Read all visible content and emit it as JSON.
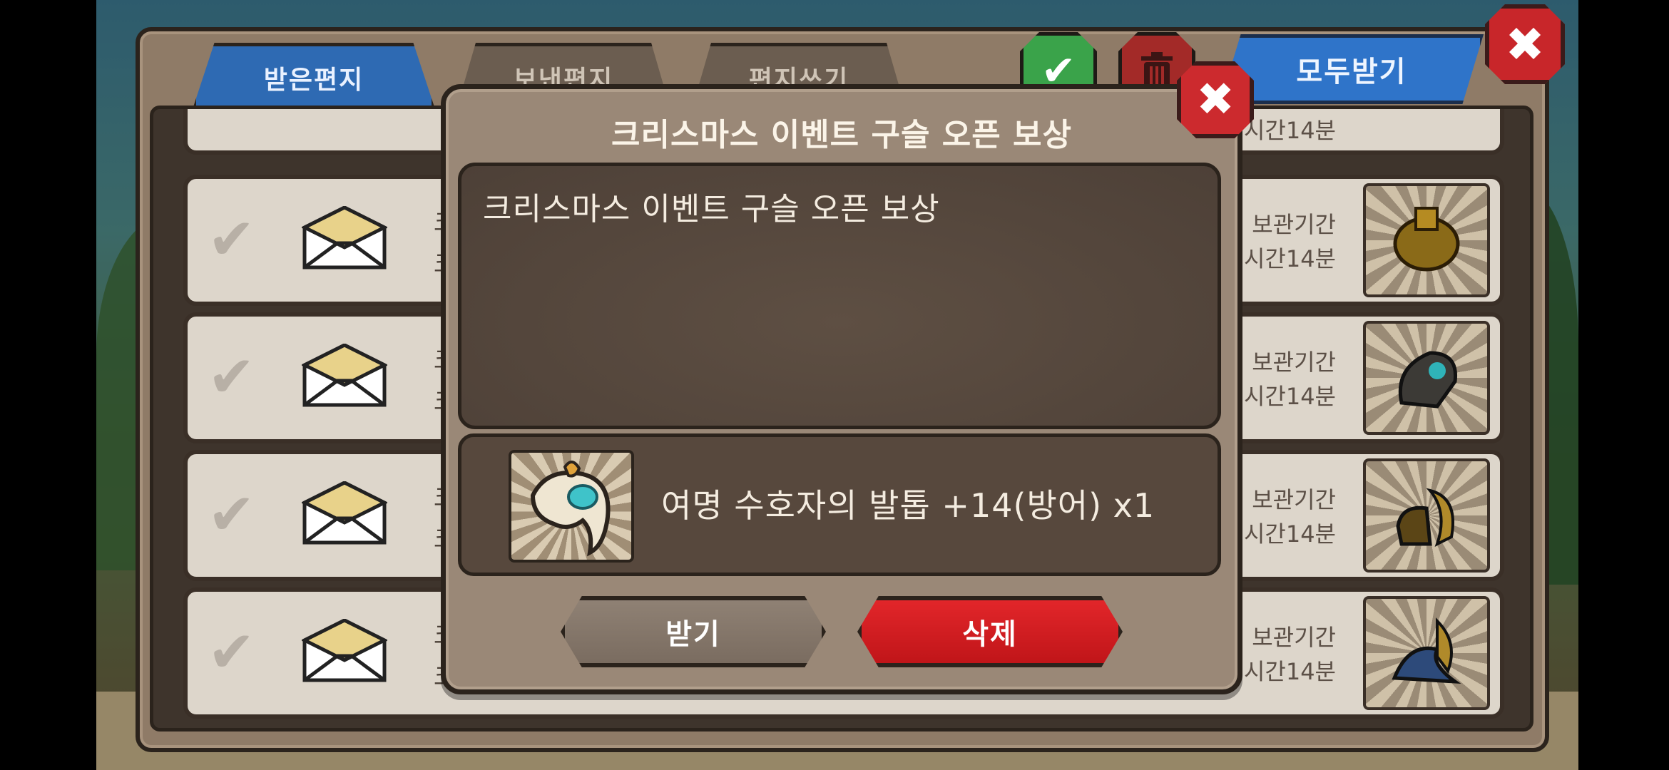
{
  "mailbox": {
    "tabs": [
      {
        "label": "받은편지",
        "active": true
      },
      {
        "label": "보낸편지",
        "active": false
      },
      {
        "label": "편지쓰기",
        "active": false
      }
    ],
    "receive_all_label": "모두받기",
    "rows": [
      {
        "sender_line1": "크",
        "sender_line2": "크",
        "keep_line1": "보관기간",
        "keep_line2": "시간14분"
      },
      {
        "sender_line1": "크",
        "sender_line2": "크",
        "keep_line1": "보관기간",
        "keep_line2": "시간14분"
      },
      {
        "sender_line1": "크",
        "sender_line2": "크",
        "keep_line1": "보관기간",
        "keep_line2": "시간14분"
      },
      {
        "sender_line1": "크",
        "sender_line2": "크",
        "keep_line1": "보관기간",
        "keep_line2": "시간14분"
      }
    ],
    "top_partial_row_keep": "시간14분"
  },
  "modal": {
    "title": "크리스마스 이벤트 구슬 오픈 보상",
    "message": "크리스마스 이벤트 구슬 오픈 보상",
    "reward_text": "여명 수호자의 발톱 +14(방어) x1",
    "receive_label": "받기",
    "delete_label": "삭제"
  },
  "colors": {
    "tab_active": "#2e6ab3",
    "delete_button": "#c01519",
    "receive_button": "#8f8174",
    "modal_bg": "#9a8877"
  },
  "icons": [
    "close-icon",
    "check-icon",
    "trash-icon",
    "envelope-icon"
  ]
}
